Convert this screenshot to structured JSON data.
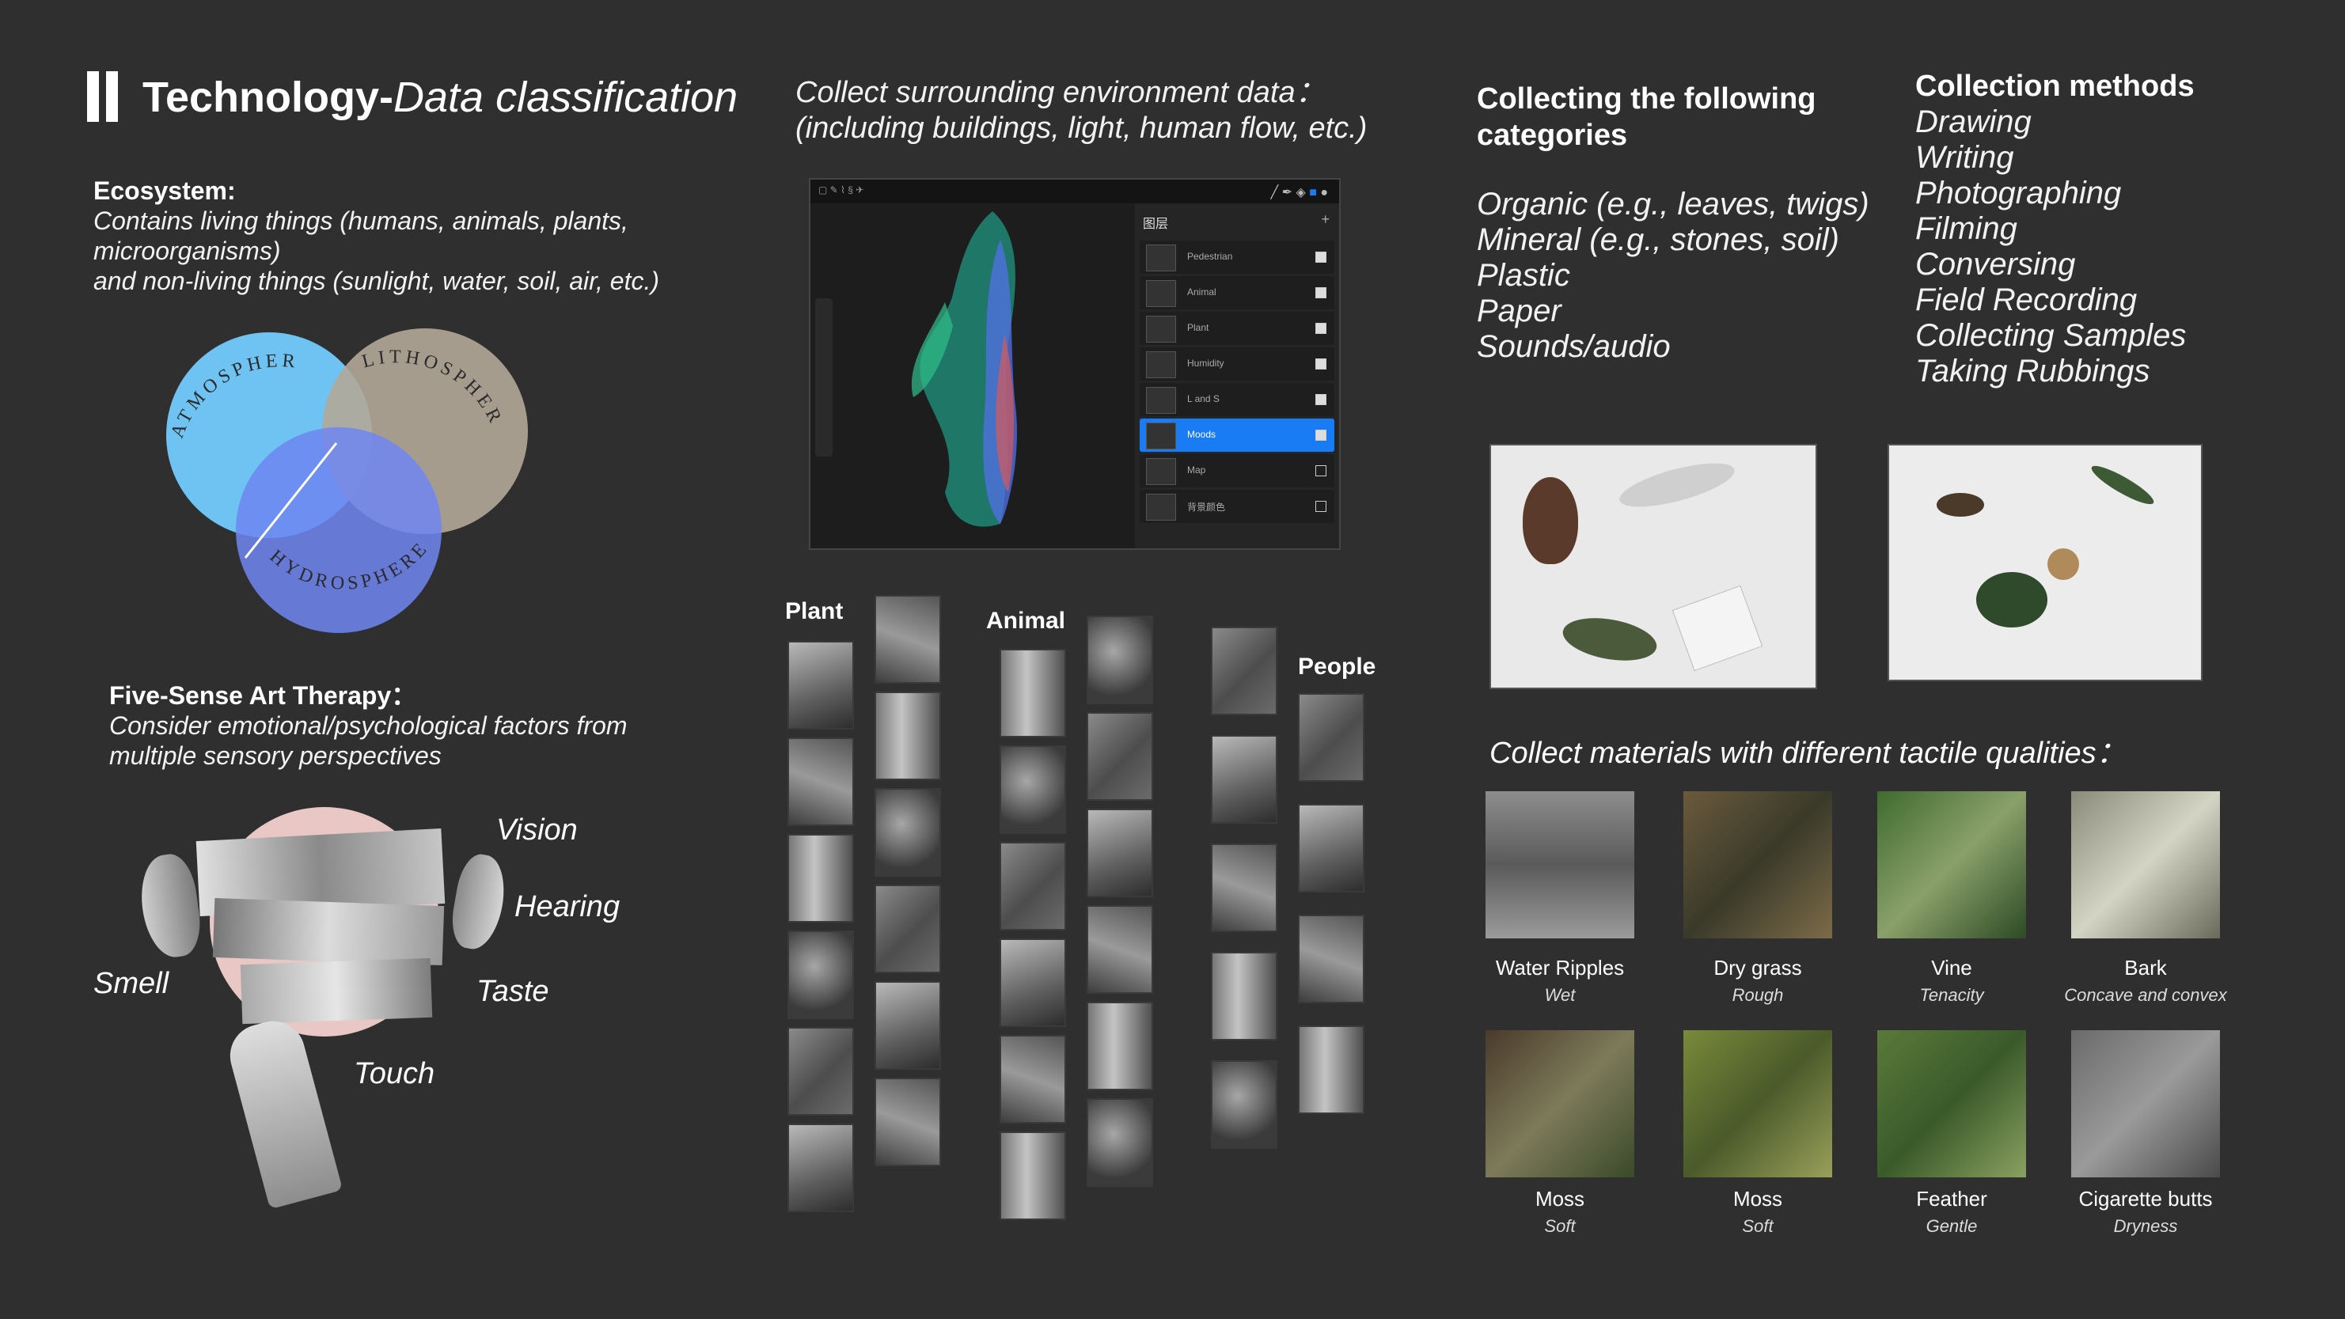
{
  "title": {
    "main": "Technology-",
    "sub": "Data classification"
  },
  "ecosystem": {
    "heading": "Ecosystem:",
    "line1": "Contains living things (humans, animals, plants,",
    "line2": "microorganisms)",
    "line3": "and non-living things (sunlight, water, soil, air, etc.)"
  },
  "venn": {
    "a": "ATMOSPHERE",
    "b": "LITHOSPHERE",
    "c": "HYDROSPHERE"
  },
  "five_sense": {
    "heading": "Five-Sense Art Therapy：",
    "line1": "Consider emotional/psychological factors from",
    "line2": "multiple sensory perspectives",
    "vision": "Vision",
    "hearing": "Hearing",
    "smell": "Smell",
    "taste": "Taste",
    "touch": "Touch"
  },
  "collect_env": {
    "line1": "Collect surrounding environment data：",
    "line2": "(including buildings, light, human flow, etc.)"
  },
  "layers_panel": {
    "title": "图层",
    "layers": [
      "Pedestrian",
      "Animal",
      "Plant",
      "Humidity",
      "L and S",
      "Moods",
      "Map",
      "背景颜色"
    ],
    "selected_index": 5
  },
  "groups": {
    "plant": "Plant",
    "animal": "Animal",
    "people": "People"
  },
  "categories": {
    "heading_line1": "Collecting the following",
    "heading_line2": "categories",
    "items": [
      "Organic (e.g., leaves, twigs)",
      "Mineral (e.g., stones, soil)",
      "Plastic",
      "Paper",
      "Sounds/audio"
    ]
  },
  "methods": {
    "heading": "Collection methods",
    "items": [
      "Drawing",
      "Writing",
      "Photographing",
      "Filming",
      "Conversing",
      "Field Recording",
      "Collecting Samples",
      "Taking Rubbings"
    ]
  },
  "tactile": {
    "heading": "Collect materials with different tactile qualities：",
    "items": [
      {
        "name": "Water Ripples",
        "quality": "Wet"
      },
      {
        "name": "Dry grass",
        "quality": "Rough"
      },
      {
        "name": "Vine",
        "quality": "Tenacity"
      },
      {
        "name": "Bark",
        "quality": "Concave and convex"
      },
      {
        "name": "Moss",
        "quality": "Soft"
      },
      {
        "name": "Moss",
        "quality": "Soft"
      },
      {
        "name": "Feather",
        "quality": "Gentle"
      },
      {
        "name": "Cigarette butts",
        "quality": "Dryness"
      }
    ]
  },
  "colors": {
    "background": "#2f2f2f",
    "atmosphere": "#6ec3f2",
    "lithosphere": "#b3a999",
    "hydrosphere": "#6f86f2",
    "selected_layer": "#1a7cf5"
  }
}
